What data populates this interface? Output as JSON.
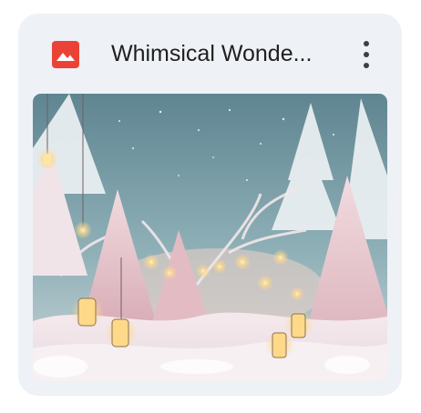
{
  "file_card": {
    "type_icon": "image-file-icon",
    "title": "Whimsical Wonde...",
    "menu_icon": "more-vert-icon",
    "thumbnail_subject": "thumbnail-image"
  },
  "colors": {
    "card_background": "#eef1f6",
    "image_icon_red": "#ea4335",
    "title_text": "#1f1f1f",
    "menu_dots": "#3c4043"
  }
}
